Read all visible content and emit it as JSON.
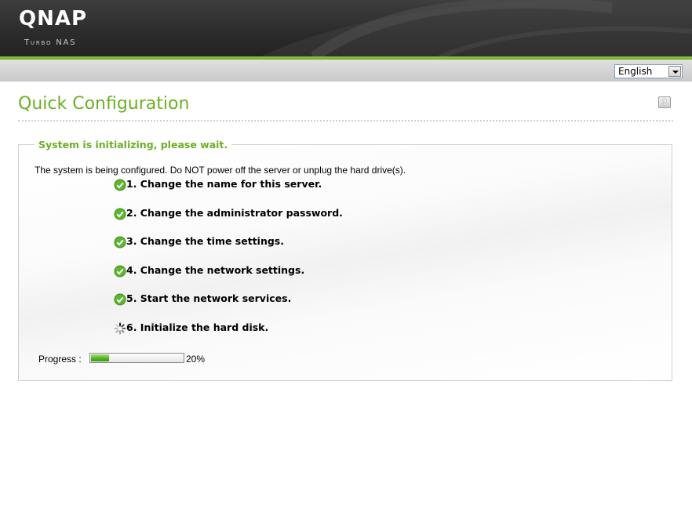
{
  "header": {
    "logo": "QNAP",
    "product": "Turbo NAS"
  },
  "language": {
    "selected": "English"
  },
  "page": {
    "title": "Quick Configuration",
    "help_icon": "help-icon"
  },
  "panel": {
    "legend": "System is initializing, please wait.",
    "notice": "The system is being configured. Do NOT power off the server or unplug the hard drive(s).",
    "steps": [
      {
        "label": "1. Change the name for this server.",
        "status": "done"
      },
      {
        "label": "2. Change the administrator password.",
        "status": "done"
      },
      {
        "label": "3. Change the time settings.",
        "status": "done"
      },
      {
        "label": "4. Change the network settings.",
        "status": "done"
      },
      {
        "label": "5. Start the network services.",
        "status": "done"
      },
      {
        "label": "6. Initialize the hard disk.",
        "status": "in-progress"
      }
    ],
    "progress": {
      "label": "Progress :",
      "percent": 20,
      "percent_text": "20%"
    }
  },
  "colors": {
    "accent_green": "#6ab023",
    "header_dark": "#2c2c2c"
  }
}
